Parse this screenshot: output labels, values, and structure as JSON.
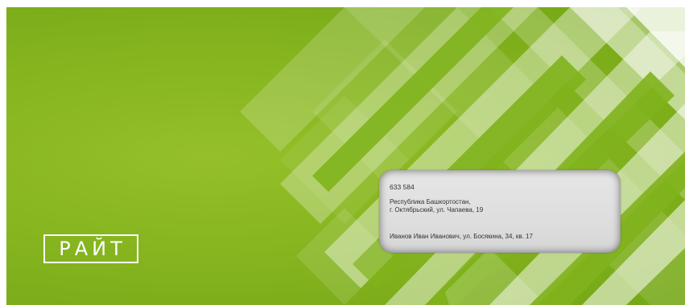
{
  "brand": {
    "logo_text": "РАЙТ"
  },
  "address": {
    "postal_code": "633 584",
    "region": "Республика Башкортостан,",
    "city_street": "г. Октябрьский, ул. Чапаева, 19",
    "recipient": "Иванов Иван Иванович, ул. Босякина, 34, кв. 17"
  },
  "colors": {
    "background_green": "#86b51f",
    "stripe_light": "#d4e5a8",
    "logo": "#ffffff",
    "address_window": "#e0e0e0"
  }
}
